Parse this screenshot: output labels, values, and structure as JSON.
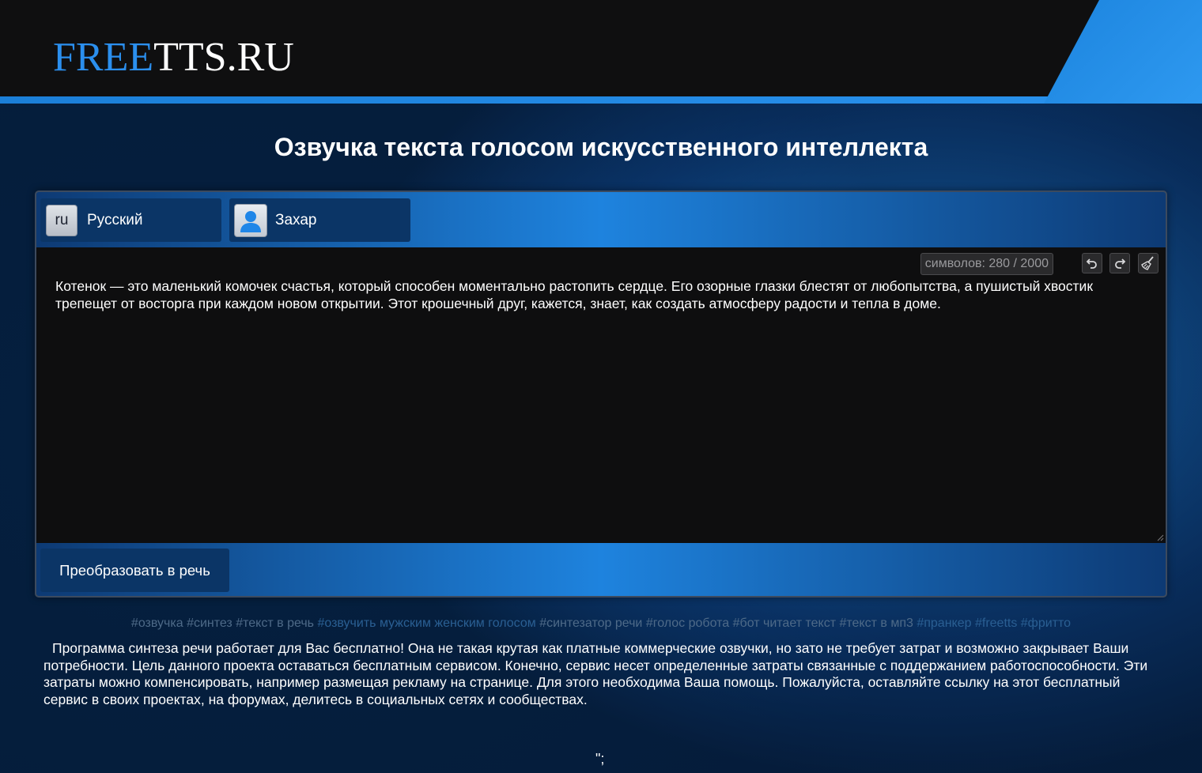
{
  "header": {
    "logo_part_a": "FREE",
    "logo_part_b": "TTS.RU",
    "colors": {
      "brand_blue": "#2b8fee",
      "header_bg": "#0f0f10"
    }
  },
  "page_title": "Озвучка текста голосом искусственного интеллекта",
  "selectors": {
    "language": {
      "code": "ru",
      "label": "Русский"
    },
    "voice": {
      "icon": "user-avatar-icon",
      "label": "Захар"
    }
  },
  "editor": {
    "counter": "символов: 280 / 2000",
    "tools": [
      "undo-icon",
      "redo-icon",
      "clear-broom-icon"
    ],
    "text": "Котенок — это маленький комочек счастья, который способен моментально растопить сердце. Его озорные глазки блестят от любопытства, а пушистый хвостик трепещет от восторга при каждом новом открытии. Этот крошечный друг, кажется, знает, как создать атмосферу радости и тепла в доме."
  },
  "convert_button": "Преобразовать в речь",
  "tags": [
    "#озвучка",
    "#синтез",
    "#текст в речь",
    "#озвучить мужским женским голосом",
    "#синтезатор речи",
    "#голос робота",
    "#бот читает текст",
    "#текст в мп3",
    "#пранкер",
    "#freetts",
    "#фритто"
  ],
  "description": "Программа синтеза речи работает для Вас бесплатно! Она не такая крутая как платные коммерческие озвучки, но зато не требует затрат и возможно закрывает Ваши потребности. Цель данного проекта оставаться бесплатным сервисом. Конечно, сервис несет определенные затраты связанные с поддержанием работоспособности. Эти затраты можно компенсировать, например размещая рекламу на странице. Для этого необходима Ваша помощь. Пожалуйста, оставляйте ссылку на этот бесплатный сервис в своих проектах, на форумах, делитесь в социальных сетях и сообществах.",
  "stray_text": "\";"
}
